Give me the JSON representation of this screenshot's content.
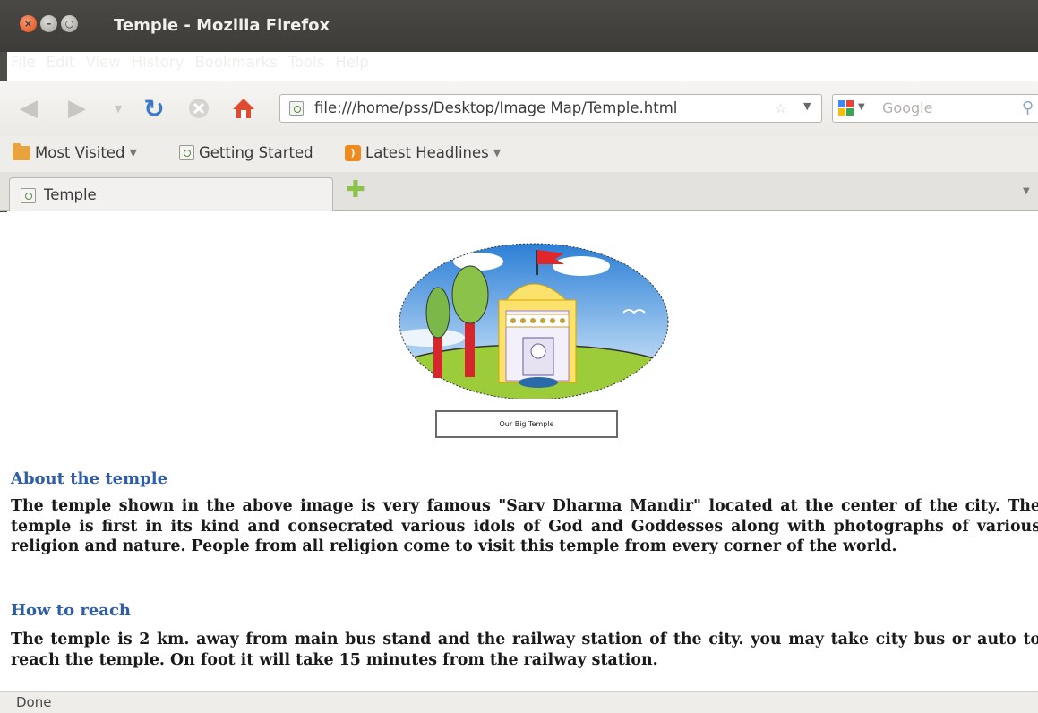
{
  "window": {
    "title": "Temple - Mozilla Firefox"
  },
  "menu": [
    "File",
    "Edit",
    "View",
    "History",
    "Bookmarks",
    "Tools",
    "Help"
  ],
  "urlbar": {
    "url": "file:///home/pss/Desktop/Image Map/Temple.html"
  },
  "search": {
    "placeholder": "Google"
  },
  "bookmarks": {
    "most_visited": "Most Visited",
    "getting_started": "Getting Started",
    "latest_headlines": "Latest Headlines"
  },
  "tab": {
    "label": "Temple"
  },
  "page": {
    "image_caption": "Our Big Temple",
    "about_heading": "About the temple",
    "about_text": "The temple shown in the above image is very famous \"Sarv Dharma Mandir\" located at the center of the city. The temple is first in its kind and consecrated various idols of God and Goddesses along with photographs of various religion and nature. People from all religion come to visit this temple from every corner of the world.",
    "reach_heading": "How to reach",
    "reach_text": "The temple is 2 km. away from main bus stand and the railway station of the city. you may take city bus or auto to reach the temple. On foot it will take 15 minutes from the railway station."
  },
  "status": {
    "text": "Done"
  }
}
